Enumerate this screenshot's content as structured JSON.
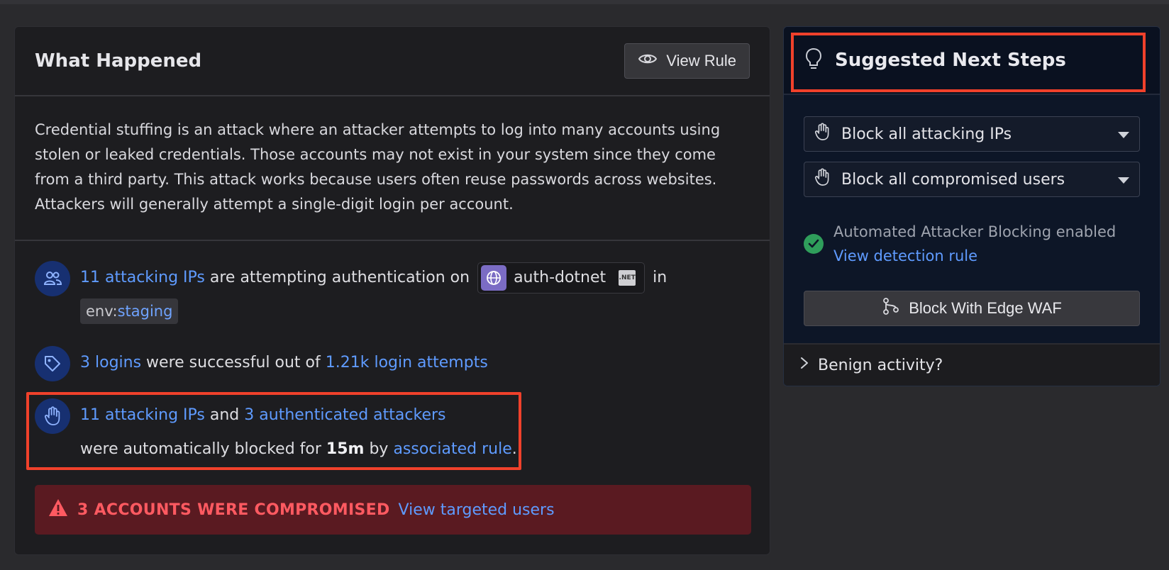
{
  "left": {
    "title": "What Happened",
    "view_rule_label": "View Rule",
    "description": "Credential stuffing is an attack where an attacker attempts to log into many accounts using stolen or leaked credentials. Those accounts may not exist in your system since they come from a third party. This attack works because users often reuse passwords across websites. Attackers will generally attempt a single-digit login per account.",
    "fact1": {
      "link_ips": "11 attacking IPs",
      "text_mid": " are attempting authentication on ",
      "service_name": "auth-dotnet",
      "service_badge": ".NET",
      "text_in": " in",
      "env_key": "env:",
      "env_value": "staging"
    },
    "fact2": {
      "link_logins": "3 logins",
      "text_mid": " were successful out of ",
      "link_attempts": "1.21k login attempts"
    },
    "fact3": {
      "link_ips": "11 attacking IPs",
      "text_and": " and ",
      "link_attackers": "3 authenticated attackers",
      "text_blocked": "were automatically blocked for ",
      "duration": "15m",
      "text_by": " by ",
      "link_rule": "associated rule",
      "text_end": "."
    },
    "alert": {
      "text": "3 ACCOUNTS WERE COMPROMISED",
      "link": "View targeted users"
    }
  },
  "right": {
    "title": "Suggested Next Steps",
    "select1": "Block all attacking IPs",
    "select2": "Block all compromised users",
    "auto_status": "Automated Attacker Blocking enabled",
    "auto_link": "View detection rule",
    "waf_button": "Block With Edge WAF",
    "benign": "Benign activity?"
  },
  "colors": {
    "accent_link": "#5f9bff",
    "alert_bg": "#5a1a21",
    "alert_text": "#ff5a61",
    "highlight": "#f0412b",
    "success": "#2f9e5b"
  },
  "icons": [
    "eye-icon",
    "users-icon",
    "tag-icon",
    "hand-icon",
    "globe-icon",
    "warning-icon",
    "lightbulb-icon",
    "check-icon",
    "git-branch-icon",
    "chevron-right-icon",
    "caret-down-icon"
  ]
}
